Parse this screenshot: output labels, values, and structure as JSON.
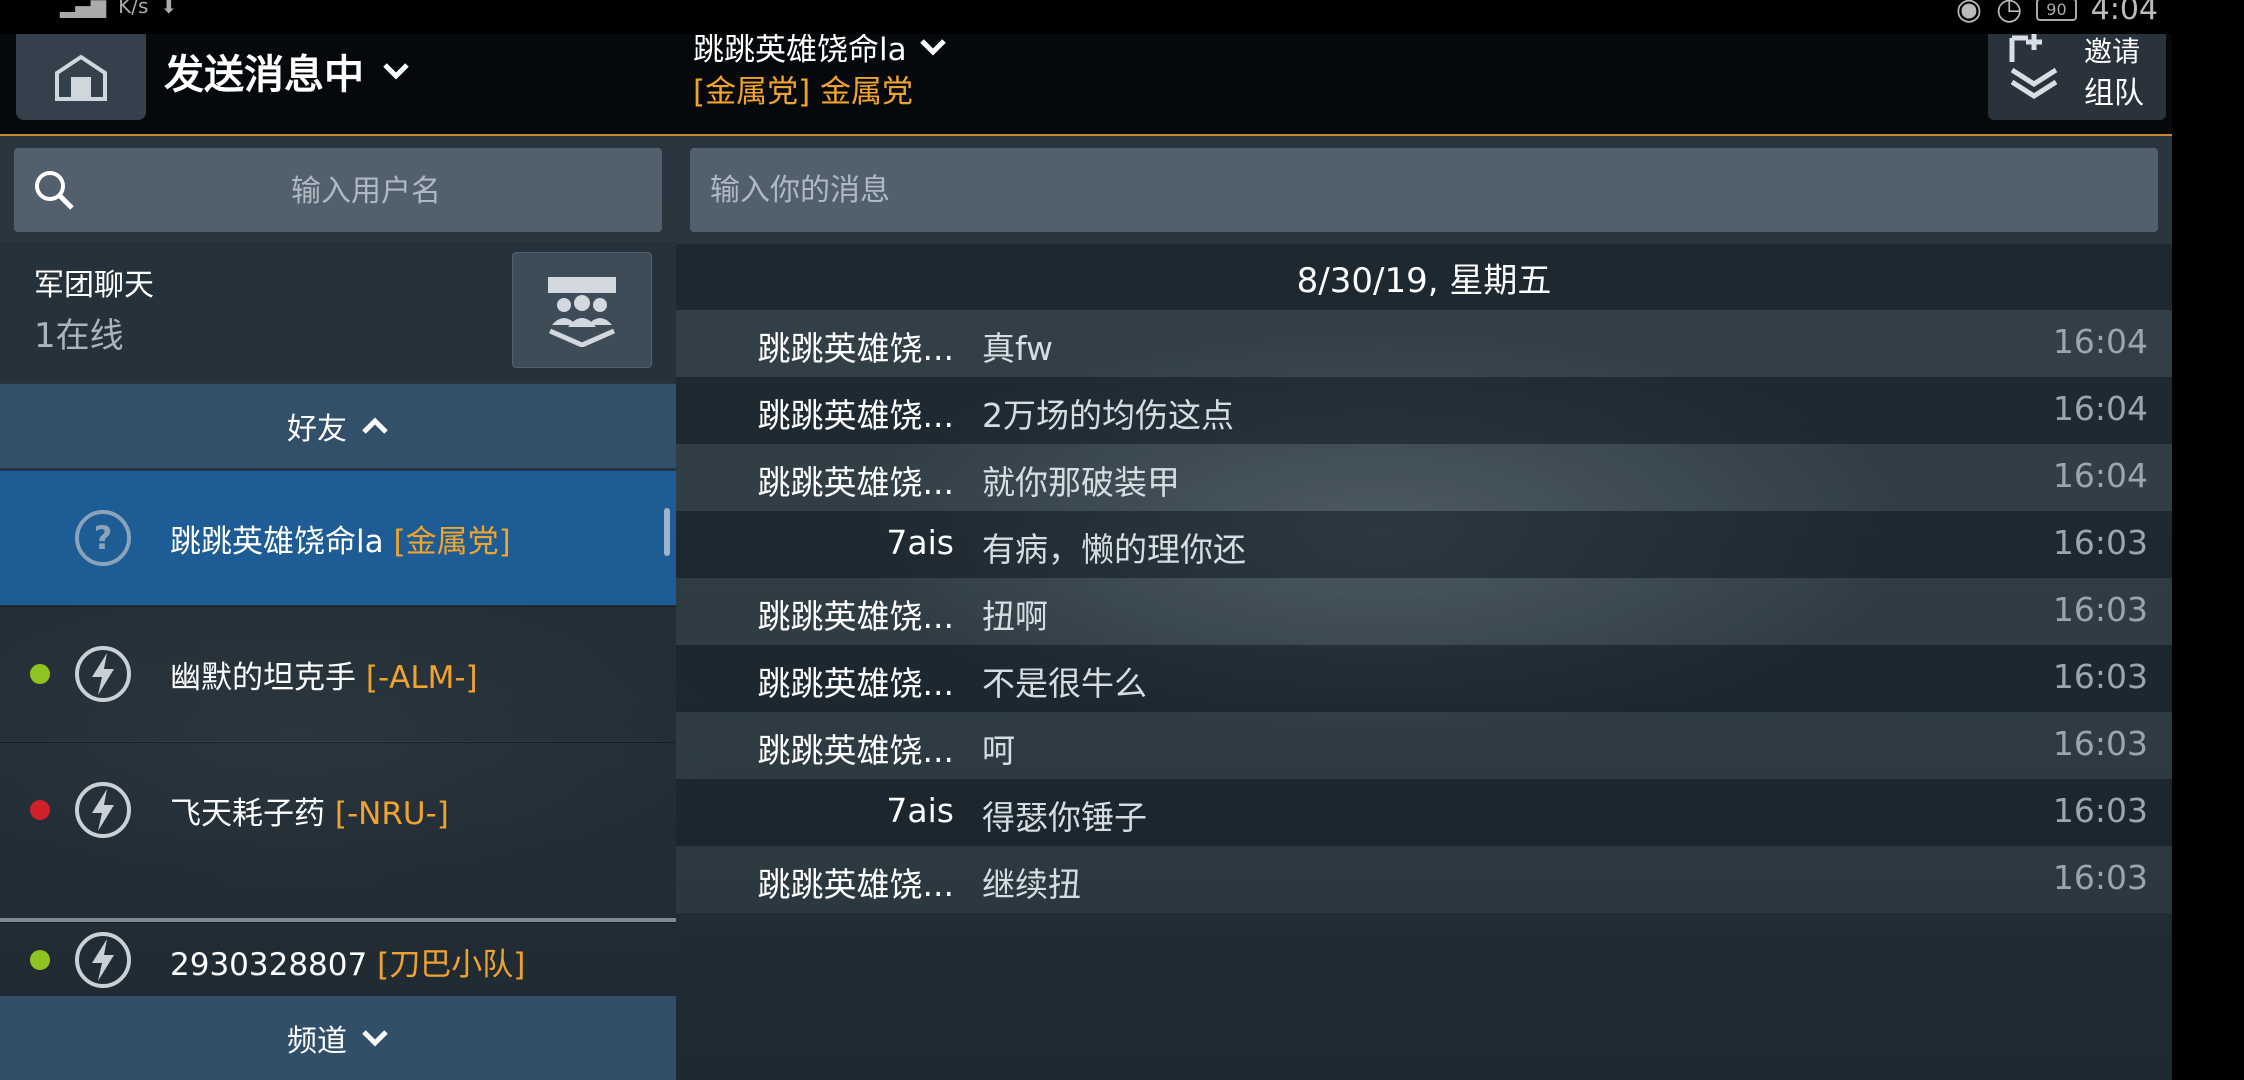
{
  "status_bar": {
    "left_text": "K/s",
    "time": "4:04",
    "battery": "90"
  },
  "header": {
    "title": "发送消息中",
    "chat_user": "跳跳英雄饶命la",
    "chat_clan": "[金属党] 金属党",
    "invite_line1": "邀请",
    "invite_line2": "组队"
  },
  "left": {
    "user_search_placeholder": "输入用户名",
    "clan_chat": {
      "title": "军团聊天",
      "online": "1在线"
    },
    "friends_header": "好友",
    "friends": [
      {
        "name": "跳跳英雄饶命la",
        "clan": "[金属党]",
        "status": "unknown",
        "status_color": "",
        "selected": true
      },
      {
        "name": "幽默的坦克手",
        "clan": "[-ALM-]",
        "status": "online",
        "status_color": "#8fc320",
        "selected": false
      },
      {
        "name": "飞天耗子药",
        "clan": "[-NRU-]",
        "status": "busy",
        "status_color": "#d0202a",
        "selected": false
      },
      {
        "name": "2930328807",
        "clan": "[刀巴小队]",
        "status": "online",
        "status_color": "#8fc320",
        "selected": false
      }
    ],
    "channels_header": "频道"
  },
  "right": {
    "message_placeholder": "输入你的消息",
    "date_header": "8/30/19, 星期五",
    "messages": [
      {
        "sender": "跳跳英雄饶...",
        "text": "真fw",
        "time": "16:04"
      },
      {
        "sender": "跳跳英雄饶...",
        "text": "2万场的均伤这点",
        "time": "16:04"
      },
      {
        "sender": "跳跳英雄饶...",
        "text": "就你那破装甲",
        "time": "16:04"
      },
      {
        "sender": "7ais",
        "text": "有病，懒的理你还",
        "time": "16:03"
      },
      {
        "sender": "跳跳英雄饶...",
        "text": "扭啊",
        "time": "16:03"
      },
      {
        "sender": "跳跳英雄饶...",
        "text": "不是很牛么",
        "time": "16:03"
      },
      {
        "sender": "跳跳英雄饶...",
        "text": "呵",
        "time": "16:03"
      },
      {
        "sender": "7ais",
        "text": "得瑟你锤子",
        "time": "16:03"
      },
      {
        "sender": "跳跳英雄饶...",
        "text": "继续扭",
        "time": "16:03"
      }
    ]
  },
  "colors": {
    "accent": "#c98a2c",
    "clan_tag": "#f0a42e",
    "selected_row": "#1d5c94",
    "online": "#8fc320",
    "busy": "#d0202a"
  }
}
